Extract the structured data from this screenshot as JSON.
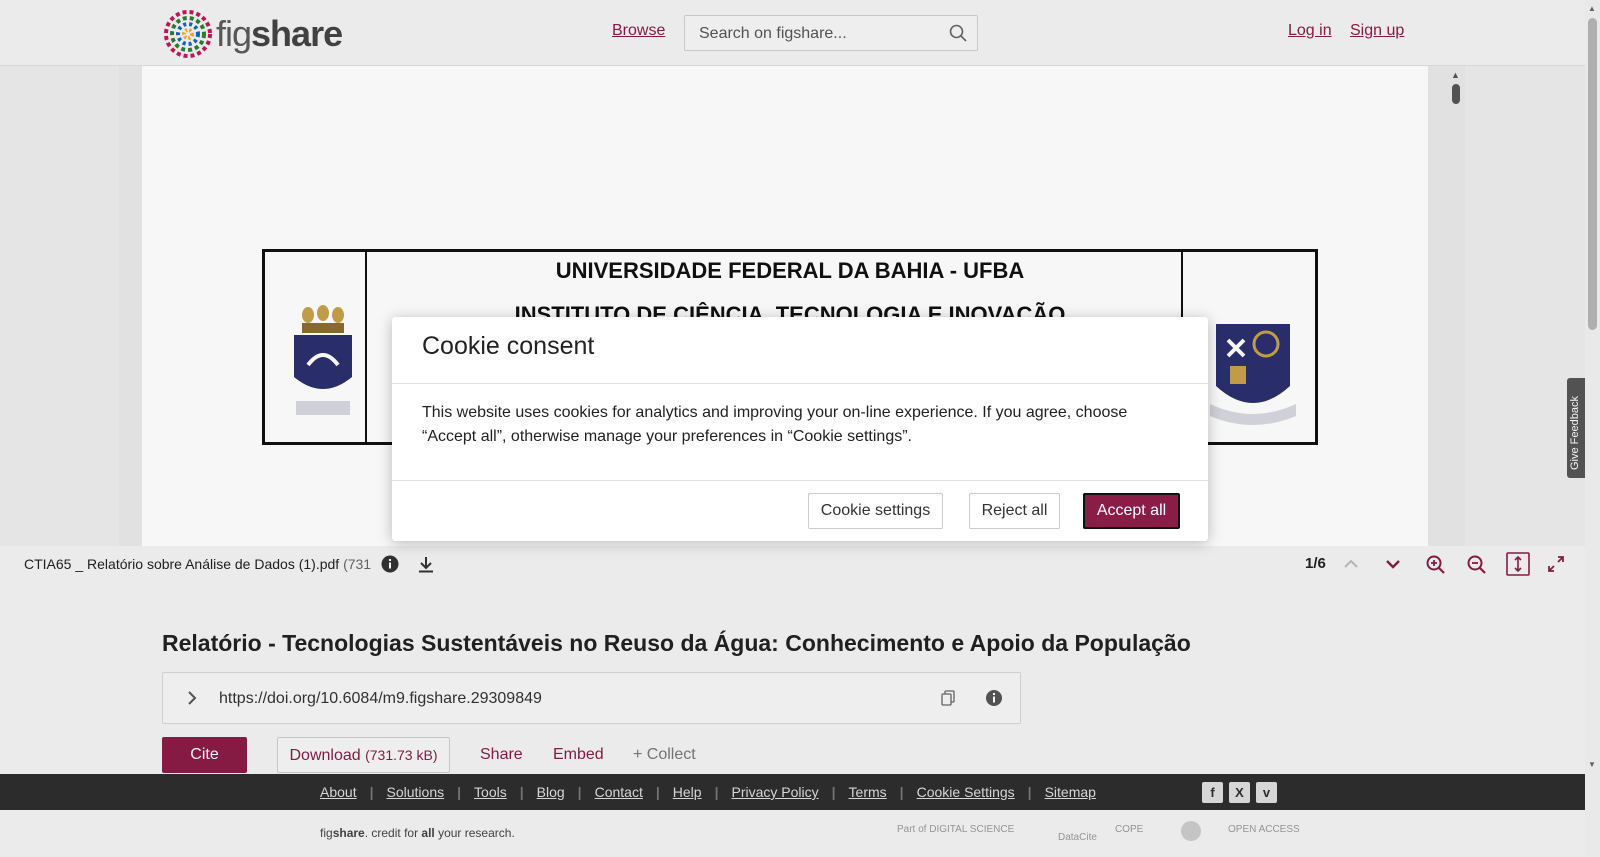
{
  "header": {
    "logo_text_light": "fig",
    "logo_text_bold": "share",
    "browse": "Browse",
    "search_placeholder": "Search on figshare...",
    "login": "Log in",
    "signup": "Sign up"
  },
  "viewer": {
    "doc_title_line1": "UNIVERSIDADE FEDERAL DA BAHIA - UFBA",
    "doc_title_line2": "INSTITUTO DE CIÊNCIA, TECNOLOGIA E INOVAÇÃO",
    "file_name": "CTIA65 _ Relatório sobre Análise de Dados (1).pdf",
    "file_size_partial": "(731",
    "page_indicator": "1/6"
  },
  "item": {
    "title": "Relatório - Tecnologias Sustentáveis no Reuso da Água: Conhecimento e Apoio da População",
    "doi": "https://doi.org/10.6084/m9.figshare.29309849",
    "cite": "Cite",
    "download": "Download",
    "download_size": "(731.73 kB)",
    "share": "Share",
    "embed": "Embed",
    "collect": "+ Collect"
  },
  "feedback": "Give Feedback",
  "footer": {
    "links": [
      "About",
      "Solutions",
      "Tools",
      "Blog",
      "Contact",
      "Help",
      "Privacy Policy",
      "Terms",
      "Cookie Settings",
      "Sitemap"
    ],
    "credit_pre": "fig",
    "credit_bold": "share",
    "credit_mid": ". credit for ",
    "credit_all": "all",
    "credit_post": " your research.",
    "partner_ds": "Part of DIGITAL SCIENCE",
    "partner_datacite": "DataCite",
    "partner_cope": "COPE",
    "partner_oa": "OPEN ACCESS"
  },
  "cookie": {
    "title": "Cookie consent",
    "body": "This website uses cookies for analytics and improving your on-line experience. If you agree, choose “Accept all”, otherwise manage your preferences in “Cookie settings”.",
    "settings": "Cookie settings",
    "reject": "Reject all",
    "accept": "Accept all"
  },
  "colors": {
    "brand": "#8a1c45",
    "footer_bg": "#2e2e2e"
  }
}
